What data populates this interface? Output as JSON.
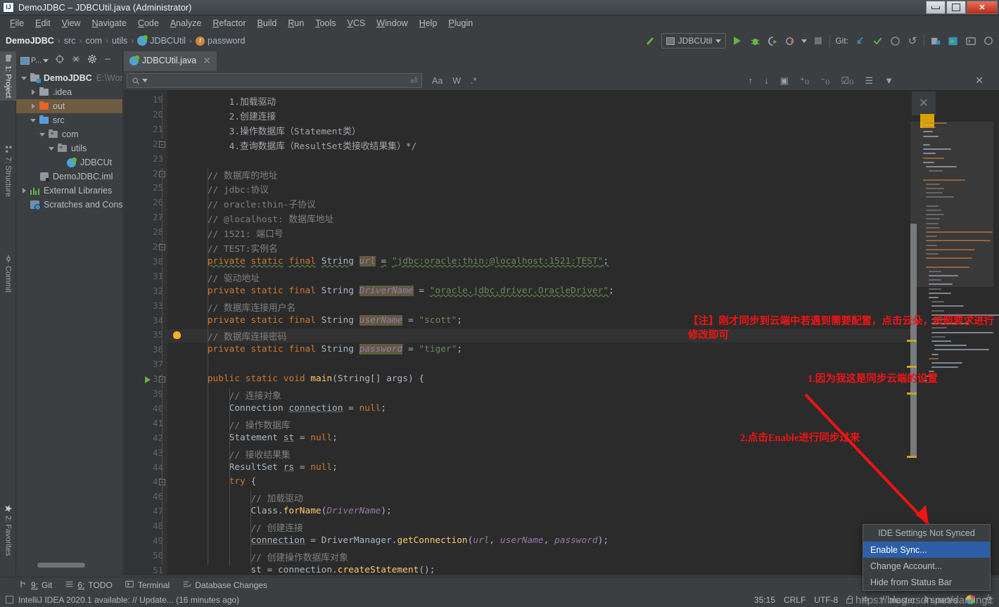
{
  "window": {
    "title": "DemoJDBC – JDBCUtil.java (Administrator)",
    "icon": "intellij-idea-icon",
    "minimize": "minimize-icon",
    "maximize": "maximize-icon",
    "close": "close-icon"
  },
  "menubar": [
    "File",
    "Edit",
    "View",
    "Navigate",
    "Code",
    "Analyze",
    "Refactor",
    "Build",
    "Run",
    "Tools",
    "VCS",
    "Window",
    "Help",
    "Plugin"
  ],
  "breadcrumb": [
    "DemoJDBC",
    "src",
    "com",
    "utils",
    "JDBCUtil",
    "password"
  ],
  "toolbar": {
    "run_config": "JDBCUtil",
    "git_label": "Git:",
    "buttons": [
      "build-icon",
      "run-button",
      "debug-button",
      "run-coverage-button",
      "profile-button",
      "stop-button",
      "update-project-button",
      "commit-button",
      "history-button",
      "rollback-button",
      "search-everywhere-button",
      "settings-sync-button",
      "terminal-button"
    ]
  },
  "left_rail": [
    {
      "label": "1: Project",
      "icon": "project-icon",
      "selected": true
    },
    {
      "label": "7: Structure",
      "icon": "structure-icon",
      "selected": false
    },
    {
      "label": "Commit",
      "icon": "commit-icon",
      "selected": false
    },
    {
      "label": "2: Favorites",
      "icon": "favorites-star-icon",
      "selected": false
    }
  ],
  "project_panel": {
    "title": "P...",
    "toolbar_icons": [
      "project-view-selector",
      "locate-icon",
      "collapse-all-icon",
      "settings-gear-icon",
      "hide-icon"
    ],
    "tree": [
      {
        "indent": 0,
        "twisty": "down",
        "icon": "project-folder-icon",
        "label": "DemoJDBC",
        "bold": true,
        "path": "E:\\Wor",
        "highlighted": false
      },
      {
        "indent": 1,
        "twisty": "right",
        "icon": "folder-gray-icon",
        "label": ".idea",
        "bold": false,
        "path": "",
        "highlighted": false
      },
      {
        "indent": 1,
        "twisty": "right",
        "icon": "folder-orange-icon",
        "label": "out",
        "bold": false,
        "path": "",
        "highlighted": true
      },
      {
        "indent": 1,
        "twisty": "down",
        "icon": "folder-blue-icon",
        "label": "src",
        "bold": false,
        "path": "",
        "highlighted": false
      },
      {
        "indent": 2,
        "twisty": "down",
        "icon": "package-icon",
        "label": "com",
        "bold": false,
        "path": "",
        "highlighted": false
      },
      {
        "indent": 3,
        "twisty": "down",
        "icon": "package-icon",
        "label": "utils",
        "bold": false,
        "path": "",
        "highlighted": false
      },
      {
        "indent": 4,
        "twisty": "none",
        "icon": "java-class-icon",
        "label": "JDBCUt",
        "bold": false,
        "path": "",
        "highlighted": false
      },
      {
        "indent": 1,
        "twisty": "none",
        "icon": "iml-file-icon",
        "label": "DemoJDBC.iml",
        "bold": false,
        "path": "",
        "highlighted": false
      },
      {
        "indent": 0,
        "twisty": "right",
        "icon": "libraries-icon",
        "label": "External Libraries",
        "bold": false,
        "path": "",
        "highlighted": false
      },
      {
        "indent": 0,
        "twisty": "none",
        "icon": "scratches-icon",
        "label": "Scratches and Cons",
        "bold": false,
        "path": "",
        "highlighted": false
      }
    ]
  },
  "editor": {
    "tab": {
      "label": "JDBCUtil.java",
      "icon": "java-class-icon",
      "close": "close-icon"
    },
    "find_bar": {
      "placeholder": "",
      "value": "",
      "icons": [
        "search-icon",
        "history-dropdown-icon",
        "regex-newline-icon",
        "match-case-icon",
        "words-icon",
        "regex-icon",
        "prev-occurrence-icon",
        "next-occurrence-icon",
        "select-all-occurrences-icon",
        "add-line-icon",
        "remove-line-icon",
        "toggle-line-icon",
        "group-icon",
        "filter-icon",
        "close-icon"
      ],
      "match_case_label": "Aa",
      "words_label": "W",
      "regex_label": ".*"
    },
    "first_line_number": 19,
    "lines": [
      {
        "n": 19,
        "html": "<span class='doc'>        1.加载驱动</span>"
      },
      {
        "n": 20,
        "html": "<span class='doc'>        2.创建连接</span>"
      },
      {
        "n": 21,
        "html": "<span class='doc'>        3.操作数据库（Statement类）</span>"
      },
      {
        "n": 22,
        "html": "<span class='doc'>        4.查询数据库（ResultSet类接收结果集）*/</span>"
      },
      {
        "n": 23,
        "html": ""
      },
      {
        "n": 24,
        "html": "<span class='cmt'>    // 数据库的地址</span>"
      },
      {
        "n": 25,
        "html": "<span class='cmt'>    // jdbc:协议</span>"
      },
      {
        "n": 26,
        "html": "<span class='cmt'>    // oracle:thin-子协议</span>"
      },
      {
        "n": 27,
        "html": "<span class='cmt'>    // @localhost: 数据库地址</span>"
      },
      {
        "n": 28,
        "html": "<span class='cmt'>    // 1521: 端口号</span>"
      },
      {
        "n": 29,
        "html": "<span class='cmt'>    // TEST:实例名</span>"
      },
      {
        "n": 30,
        "html": "    <span class='kw wavy'>private</span> <span class='kw wavy'>static</span> <span class='kw wavy'>final</span> <span class='wavy'>String</span> <span class='fld-it hi'>url</span> <span class='wavy'>=</span> <span class='str wavy'>\"jdbc:oracle:thin:@localhost:1521:TEST\"</span><span class='wavy'>;</span>"
      },
      {
        "n": 31,
        "html": "<span class='cmt'>    // 驱动地址</span>"
      },
      {
        "n": 32,
        "html": "    <span class='kw'>private</span> <span class='kw'>static</span> <span class='kw'>final</span> String <span class='fld-it hi'>DriverName</span> = <span class='str wavy'>\"oracle.jdbc.driver.OracleDriver\"</span>;"
      },
      {
        "n": 33,
        "html": "<span class='cmt'>    // 数据库连接用户名</span>"
      },
      {
        "n": 34,
        "html": "    <span class='kw'>private</span> <span class='kw'>static</span> <span class='kw'>final</span> String <span class='fld-it hi'>userName</span> = <span class='str'>\"scott\"</span>;"
      },
      {
        "n": 35,
        "html": "<span class='cmt'>    // 数据库连接密码</span>",
        "highlight": true,
        "bulb": true
      },
      {
        "n": 36,
        "html": "    <span class='kw'>private</span> <span class='kw'>static</span> <span class='kw'>final</span> String <span class='fld-it hi'>password</span> = <span class='str'>\"tiger\"</span>;"
      },
      {
        "n": 37,
        "html": ""
      },
      {
        "n": 38,
        "html": "    <span class='kw'>public</span> <span class='kw'>static</span> <span class='kw'>void</span> <span class='mth'>main</span>(String[] args) {",
        "run": true
      },
      {
        "n": 39,
        "html": "<span class='cmt'>        // 连接对象</span>"
      },
      {
        "n": 40,
        "html": "        Connection <span class='underl'>connection</span> = <span class='kw'>null</span>;"
      },
      {
        "n": 41,
        "html": "<span class='cmt'>        // 操作数据库</span>"
      },
      {
        "n": 42,
        "html": "        Statement <span class='underl'>st</span> = <span class='kw'>null</span>;"
      },
      {
        "n": 43,
        "html": "<span class='cmt'>        // 接收结果集</span>"
      },
      {
        "n": 44,
        "html": "        ResultSet <span class='underl'>rs</span> = <span class='kw'>null</span>;"
      },
      {
        "n": 45,
        "html": "        <span class='kw'>try</span> {"
      },
      {
        "n": 46,
        "html": "<span class='cmt'>            // 加载驱动</span>"
      },
      {
        "n": 47,
        "html": "            Class.<span class='mth'>forName</span>(<span class='fld-it'>DriverName</span>);"
      },
      {
        "n": 48,
        "html": "<span class='cmt'>            // 创建连接</span>"
      },
      {
        "n": 49,
        "html": "            <span class='underl'>connection</span> = DriverManager.<span class='mth'>getConnection</span>(<span class='fld-it'>url</span>, <span class='fld-it'>userName</span>, <span class='fld-it'>password</span>);"
      },
      {
        "n": 50,
        "html": "<span class='cmt'>            // 创建操作数据库对象</span>"
      },
      {
        "n": 51,
        "html": "            st = connection.<span class='mth'>createStatement</span>();"
      }
    ]
  },
  "annotations": [
    {
      "id": "note-cloud-config",
      "text": "【注】刚才同步到云端中若遇到需要配置，点击云朵，按照要求进行修改即可",
      "color": "#f01414"
    },
    {
      "id": "note-step-1",
      "text": "1.因为我这是同步云端的设置",
      "color": "#f01414"
    },
    {
      "id": "note-step-2",
      "text": "2.点击Enable进行同步过来",
      "color": "#f01414"
    }
  ],
  "context_menu": {
    "header": "IDE Settings Not Synced",
    "items": [
      {
        "label": "Enable Sync...",
        "selected": true
      },
      {
        "label": "Change Account...",
        "selected": false
      },
      {
        "label": "Hide from Status Bar",
        "selected": false
      }
    ]
  },
  "bottom_strip": [
    {
      "num": "9",
      "label": "Git",
      "icon": "git-branch-icon"
    },
    {
      "num": "6",
      "label": "TODO",
      "icon": "todo-list-icon"
    },
    {
      "num": "",
      "label": "Terminal",
      "icon": "terminal-icon"
    },
    {
      "num": "",
      "label": "Database Changes",
      "icon": "database-changes-icon"
    }
  ],
  "status_bar": {
    "message": "IntelliJ IDEA 2020.1 available: // Update... (16 minutes ago)",
    "message_icon": "notification-icon",
    "caret_position": "35:15",
    "line_separator": "CRLF",
    "encoding": "UTF-8",
    "lock_icon": "read-only-lock-icon",
    "inspections_icon": "inspections-icon",
    "branch": "master",
    "indent": "4 spaces",
    "sync_icon": "settings-sync-icon",
    "gear_icon": "ide-settings-gear-icon"
  },
  "watermark": "https://blog.csdn.net/daming1"
}
